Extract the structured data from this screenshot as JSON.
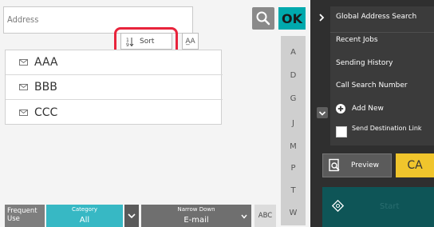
{
  "address": {
    "label": "Address"
  },
  "toolbar": {
    "search_icon": "search-icon",
    "ok_label": "OK"
  },
  "sort": {
    "sort_label": "Sort",
    "az_label": "A̲A"
  },
  "list": {
    "rows": [
      {
        "name": "AAA"
      },
      {
        "name": "BBB"
      },
      {
        "name": "CCC"
      }
    ]
  },
  "index": {
    "letters": [
      "A",
      "D",
      "G",
      "J",
      "M",
      "P",
      "T",
      "W"
    ]
  },
  "bottom": {
    "frequent_use_label": "Frequent Use",
    "category_label": "Category",
    "category_value": "All",
    "narrow_down_label": "Narrow Down",
    "narrow_down_value": "E-mail",
    "abc_label": "ABC"
  },
  "side_menu": {
    "global_search": "Global Address Search",
    "recent_jobs": "Recent Jobs",
    "sending_history": "Sending History",
    "call_search_number": "Call Search Number",
    "add_new": "Add New",
    "send_destination_link": "Send Destination Link"
  },
  "actions": {
    "preview_label": "Preview",
    "ca_label": "CA",
    "start_label": "Start"
  },
  "colors": {
    "ok": "#00a9ad",
    "highlight": "#e8243c",
    "category": "#37b8c4",
    "ca": "#f0c52c",
    "panel": "#2f2f2f"
  }
}
